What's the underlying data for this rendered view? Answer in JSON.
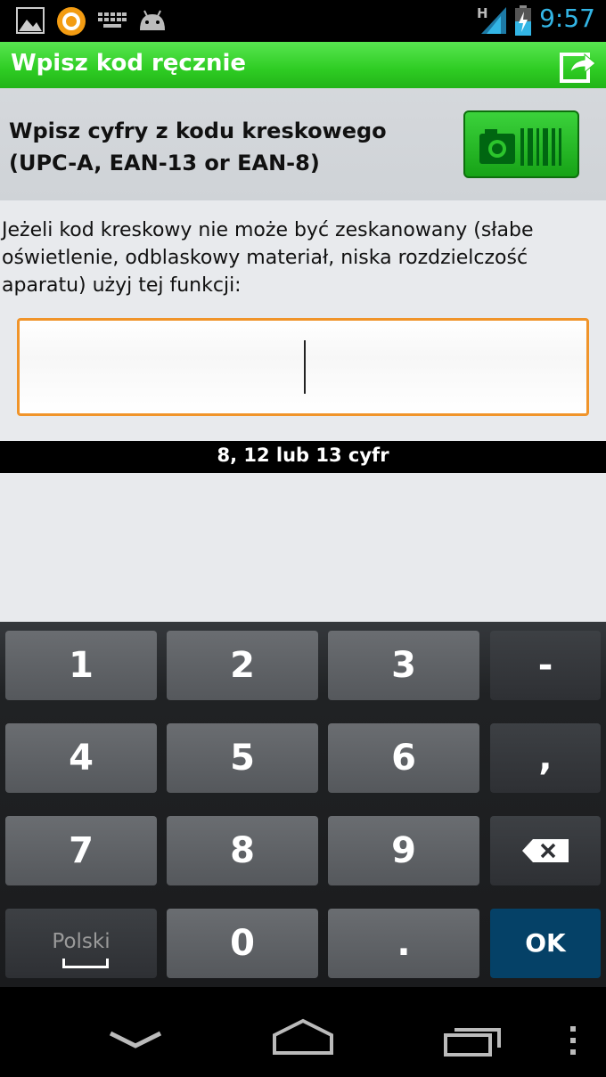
{
  "status_bar": {
    "time": "9:57",
    "network": "H",
    "icons": [
      "gallery-icon",
      "app-notification-icon",
      "keyboard-icon",
      "android-icon",
      "signal-icon",
      "battery-charging-icon"
    ]
  },
  "title_bar": {
    "title": "Wpisz kod ręcznie",
    "action_icon": "share-icon"
  },
  "header": {
    "line1": "Wpisz cyfry z kodu kreskowego",
    "line2": "(UPC-A, EAN-13 or EAN-8)",
    "scan_button_icon": "camera-barcode-icon"
  },
  "content": {
    "description": " Jeżeli kod kreskowy nie może być zeskanowany (słabe oświetlenie, odblaskowy materiał, niska rozdzielczość aparatu) użyj tej funkcji:",
    "input_value": "",
    "hint": "8, 12 lub 13 cyfr"
  },
  "keyboard": {
    "keys": {
      "k1": "1",
      "k2": "2",
      "k3": "3",
      "dash": "-",
      "k4": "4",
      "k5": "5",
      "k6": "6",
      "comma": ",",
      "k7": "7",
      "k8": "8",
      "k9": "9",
      "language": "Polski",
      "k0": "0",
      "dot": ".",
      "ok": "OK"
    }
  },
  "nav_bar": {
    "icons": [
      "hide-keyboard-icon",
      "home-icon",
      "recent-apps-icon",
      "menu-icon"
    ]
  },
  "colors": {
    "accent_green": "#2ecc23",
    "input_border": "#f0942a",
    "clock_blue": "#33b5e5",
    "ok_key": "#054167"
  }
}
